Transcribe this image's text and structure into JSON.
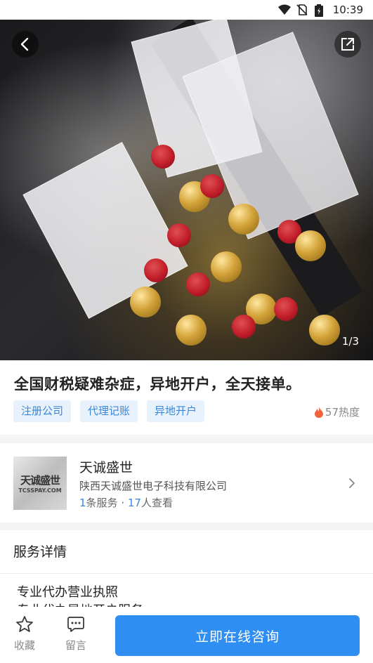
{
  "status_bar": {
    "time": "10:39",
    "icons": [
      "wifi-icon",
      "no-sim-icon",
      "battery-icon"
    ]
  },
  "hero": {
    "page_indicator": "1/3",
    "back_icon": "chevron-left-icon",
    "share_icon": "share-icon"
  },
  "product": {
    "title": "全国财税疑难杂症，异地开户，全天接单。",
    "tags": [
      "注册公司",
      "代理记账",
      "异地开户"
    ],
    "heat": "57热度"
  },
  "company": {
    "name": "天诚盛世",
    "full_name": "陕西天诚盛世电子科技有限公司",
    "logo_text": "天诚盛世",
    "logo_subtext": "TCSSPAY.COM",
    "service_count": "1",
    "service_label": "条服务 · ",
    "view_count": "17",
    "view_label": "人查看"
  },
  "details": {
    "heading": "服务详情",
    "lines": [
      "专业代办营业执照",
      "专业代办异地开户服务"
    ]
  },
  "bottom_bar": {
    "favorite_label": "收藏",
    "message_label": "留言",
    "cta_label": "立即在线咨询"
  },
  "colors": {
    "accent": "#2f8ef1",
    "tag_bg": "#e8f2fd",
    "tag_text": "#3a87d8",
    "heat": "#f0643c"
  }
}
